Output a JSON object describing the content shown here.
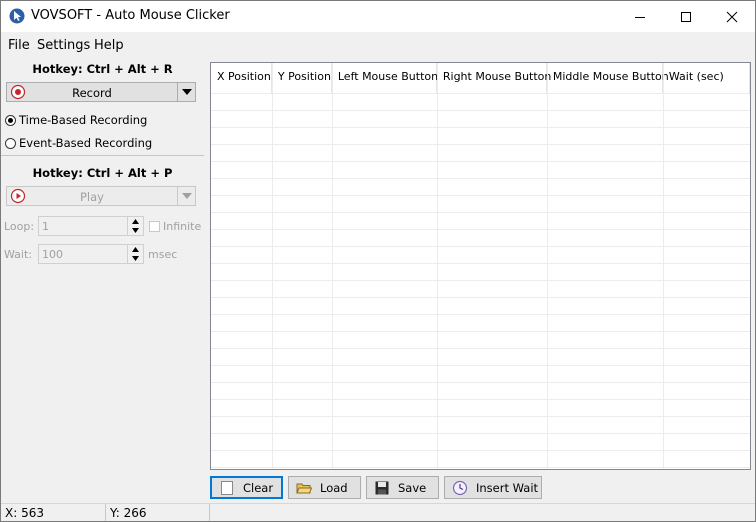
{
  "window": {
    "title": "VOVSOFT - Auto Mouse Clicker"
  },
  "menu": [
    "File",
    "Settings",
    "Help"
  ],
  "record": {
    "hotkey": "Hotkey: Ctrl + Alt + R",
    "button_label": "Record",
    "mode_options": [
      "Time-Based Recording",
      "Event-Based Recording"
    ],
    "selected_mode": "Time-Based Recording"
  },
  "play": {
    "hotkey": "Hotkey: Ctrl + Alt + P",
    "button_label": "Play",
    "loop_label": "Loop:",
    "loop_value": "1",
    "infinite_label": "Infinite",
    "wait_label": "Wait:",
    "wait_value": "100",
    "wait_unit": "msec"
  },
  "table": {
    "columns": [
      "X Position",
      "Y Position",
      "Left Mouse Button",
      "Right Mouse Button",
      "Middle Mouse Button",
      "Wait (sec)"
    ],
    "rows": []
  },
  "buttons": {
    "clear": "Clear",
    "load": "Load",
    "save": "Save",
    "insert_wait": "Insert Wait"
  },
  "status": {
    "x": "X: 563",
    "y": "Y: 266"
  },
  "colors": {
    "accent": "#0078d7",
    "record_red": "#c0282d"
  }
}
